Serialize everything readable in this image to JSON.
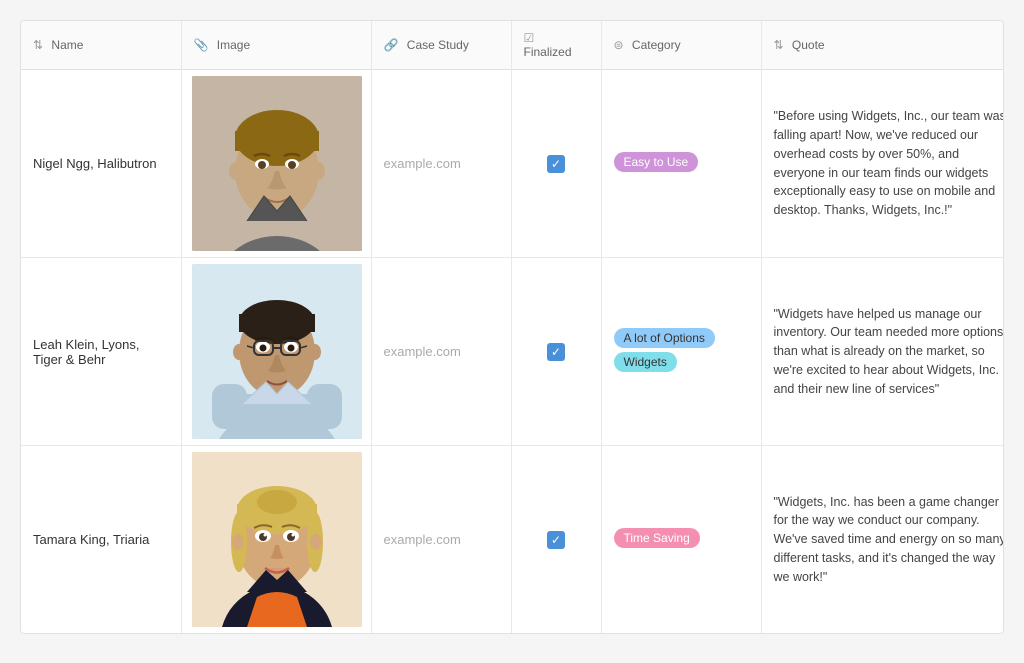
{
  "table": {
    "columns": [
      {
        "id": "name",
        "icon": "sort",
        "label": "Name"
      },
      {
        "id": "image",
        "icon": "attachment",
        "label": "Image"
      },
      {
        "id": "casestudy",
        "icon": "link",
        "label": "Case Study"
      },
      {
        "id": "finalized",
        "icon": "checkbox",
        "label": "Finalized"
      },
      {
        "id": "category",
        "icon": "database",
        "label": "Category"
      },
      {
        "id": "quote",
        "icon": "sort",
        "label": "Quote"
      }
    ],
    "rows": [
      {
        "id": "row1",
        "name": "Nigel Ngg, Halibutron",
        "image_alt": "Portrait of Nigel Ngg",
        "image_color": "#b8a898",
        "case_study_url": "example.com",
        "finalized": true,
        "categories": [
          {
            "label": "Easy to Use",
            "color": "purple"
          }
        ],
        "quote": "\"Before using Widgets, Inc., our team was falling apart! Now, we've reduced our overhead costs by over 50%, and everyone in our team finds our widgets exceptionally easy to use on mobile and desktop. Thanks, Widgets, Inc.!\""
      },
      {
        "id": "row2",
        "name": "Leah Klein, Lyons, Tiger & Behr",
        "image_alt": "Portrait of Leah Klein",
        "image_color": "#c8d8e8",
        "case_study_url": "example.com",
        "finalized": true,
        "categories": [
          {
            "label": "A lot of Options",
            "color": "blue"
          },
          {
            "label": "Widgets",
            "color": "cyan"
          }
        ],
        "quote": "\"Widgets have helped us manage our inventory. Our team needed more options than what is already on the market, so we're excited to hear about Widgets, Inc. and their new line of services\""
      },
      {
        "id": "row3",
        "name": "Tamara King, Triaria",
        "image_alt": "Portrait of Tamara King",
        "image_color": "#e8d8c0",
        "case_study_url": "example.com",
        "finalized": true,
        "categories": [
          {
            "label": "Time Saving",
            "color": "pink"
          }
        ],
        "quote": "\"Widgets, Inc. has been a game changer for the way we conduct our company. We've saved time and energy on so many different tasks, and it's changed the way we work!\""
      }
    ],
    "checkmark": "✓",
    "link_icon": "🔗",
    "sort_icon": "⇅",
    "attachment_icon": "📎",
    "db_icon": "⊜"
  }
}
